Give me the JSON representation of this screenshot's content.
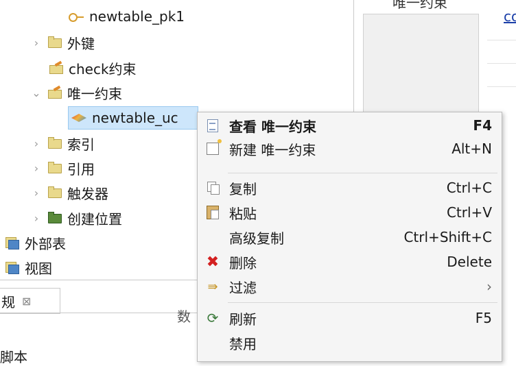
{
  "tree": {
    "items": [
      {
        "label": "newtable_pk1",
        "icon": "key-icon"
      },
      {
        "label": "外键",
        "icon": "folder-icon"
      },
      {
        "label": "check约束",
        "icon": "folder-edit-icon"
      },
      {
        "label": "唯一约束",
        "icon": "folder-edit-icon"
      },
      {
        "label": "newtable_uc",
        "icon": "unique-constraint-icon"
      },
      {
        "label": "索引",
        "icon": "folder-icon"
      },
      {
        "label": "引用",
        "icon": "folder-icon"
      },
      {
        "label": "触发器",
        "icon": "folder-icon"
      },
      {
        "label": "创建位置",
        "icon": "folder-dark-icon"
      },
      {
        "label": "外部表",
        "icon": "table-icon"
      },
      {
        "label": "视图",
        "icon": "view-icon"
      }
    ]
  },
  "bottom_panel": {
    "tab_label": "规",
    "close_glyph": "⊠",
    "column_hint": "数",
    "row_hint": "脚本"
  },
  "right_panel": {
    "link_text": "co",
    "header_text": "唯一约束"
  },
  "context_menu": {
    "items": [
      {
        "label": "查看 唯一约束",
        "shortcut": "F4",
        "icon": "edit-doc-icon",
        "bold": true
      },
      {
        "label": "新建 唯一约束",
        "shortcut": "Alt+N",
        "icon": "new-doc-icon"
      },
      {
        "label": "复制",
        "shortcut": "Ctrl+C",
        "icon": "copy-icon"
      },
      {
        "label": "粘贴",
        "shortcut": "Ctrl+V",
        "icon": "paste-icon"
      },
      {
        "label": "高级复制",
        "shortcut": "Ctrl+Shift+C",
        "icon": ""
      },
      {
        "label": "删除",
        "shortcut": "Delete",
        "icon": "delete-icon"
      },
      {
        "label": "过滤",
        "shortcut": "›",
        "icon": "filter-icon"
      },
      {
        "label": "刷新",
        "shortcut": "F5",
        "icon": "refresh-icon"
      },
      {
        "label": "禁用",
        "shortcut": "",
        "icon": ""
      }
    ]
  },
  "colors": {
    "accent_link": "#1a3ea8",
    "selection_bg": "#cde6fb",
    "delete_red": "#d32020"
  }
}
